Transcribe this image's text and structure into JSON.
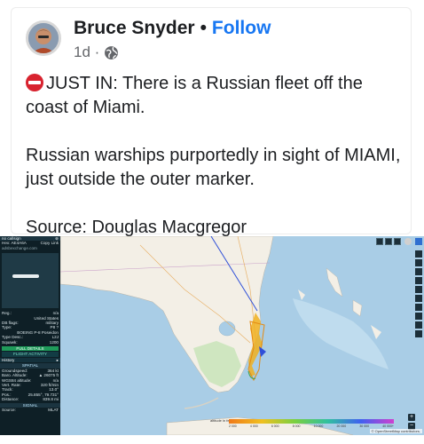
{
  "post": {
    "author": "Bruce Snyder",
    "separator": "•",
    "follow": "Follow",
    "time": "1d ·",
    "line1": "JUST IN: There is a Russian fleet off the coast of Miami.",
    "line2": "Russian warships purportedly in sight of MIAMI, just outside the outer marker.",
    "line3": "Source: Douglas Macgregor",
    "icons": {
      "alert": "no-entry-icon",
      "audience": "globe-icon"
    }
  },
  "tracker": {
    "callsign": "no callsign",
    "hex_label": "Hex:",
    "hex": "AE4A6A",
    "copy_link": "Copy Link",
    "site": "adsbexchange.com",
    "reg_label": "Reg.:",
    "reg": "n/a",
    "country": "United States",
    "db_flags_label": "DB flags:",
    "db_flags": "military",
    "type_label": "Type:",
    "type": "P8 ?",
    "type_full": "BOEING P-8 Poseidon",
    "type_desc_label": "Type Desc.:",
    "type_desc": "L2J",
    "squawk_label": "Squawk:",
    "squawk": "1200",
    "full_details": "FULL DETAILS",
    "flight_activity": "FLIGHT ACTIVITY",
    "history": "History",
    "spatial": "SPATIAL",
    "groundspeed_label": "Groundspeed:",
    "groundspeed": "364 kt",
    "baro_label": "Baro. Altitude:",
    "baro": "▲ 26075 ft",
    "wgs_label": "WGS84 altitude:",
    "wgs": "n/a",
    "vrate_label": "Vert. Rate:",
    "vrate": "320 ft/min",
    "track_label": "Track:",
    "track": "13.0°",
    "pos_label": "Pos.:",
    "pos": "25.855°, 79.731°",
    "distance_label": "Distance:",
    "distance": "839.8 mi",
    "signal": "SIGNAL",
    "source_label": "Source:",
    "source": "MLAT",
    "legend_title": "altitude in feet",
    "legend_ticks": [
      "2 000",
      "4 000",
      "6 000",
      "8 000",
      "10 000",
      "20 000",
      "30 000",
      "40 000+"
    ],
    "attribution": "© OpenStreetMap contributors.",
    "toolbar": [
      "M",
      "T",
      "⊙"
    ],
    "right_buttons": [
      "L",
      "O",
      "K",
      "I",
      "M",
      "P",
      "F",
      "R",
      "A",
      "B",
      "F"
    ],
    "colors": {
      "panel": "#0e1f26",
      "sea": "#a9cde6",
      "land": "#f3efe6",
      "track": "#f0b020",
      "route": "#2f4fd8"
    }
  }
}
